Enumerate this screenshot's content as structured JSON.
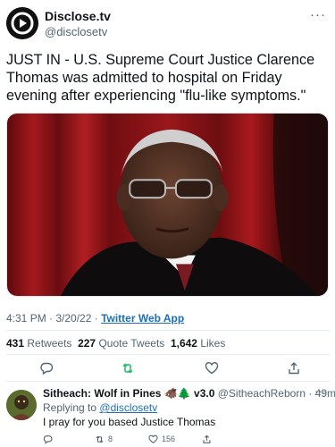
{
  "tweet": {
    "author_name": "Disclose.tv",
    "author_handle": "@disclosetv",
    "more_label": "···",
    "text": "JUST IN - U.S. Supreme Court Justice Clarence Thomas was admitted to hospital on Friday evening after experiencing \"flu-like symptoms.\"",
    "time": "4:31 PM · 3/20/22 · ",
    "source": "Twitter Web App",
    "retweets_count": "431",
    "retweets_label": "Retweets",
    "quotes_count": "227",
    "quotes_label": "Quote Tweets",
    "likes_count": "1,642",
    "likes_label": "Likes",
    "icons": [
      "reply-icon",
      "retweet-icon",
      "like-icon",
      "share-icon"
    ],
    "retweet_color": "#17bf63"
  },
  "reply": {
    "author_name": "Sitheach: Wolf in Pines",
    "emoji": "🐗🌲",
    "version": "v3.0",
    "handle_time": "@SitheachReborn · 49m",
    "more_label": "···",
    "replying_prefix": "Replying to",
    "replying_to": "@disclosetv",
    "text": "I pray for you based Justice Thomas",
    "retweet_count": "8",
    "like_count": "156"
  },
  "colors": {
    "link": "#1d6fb8",
    "muted": "#536471",
    "curtain": "#8e1418"
  }
}
